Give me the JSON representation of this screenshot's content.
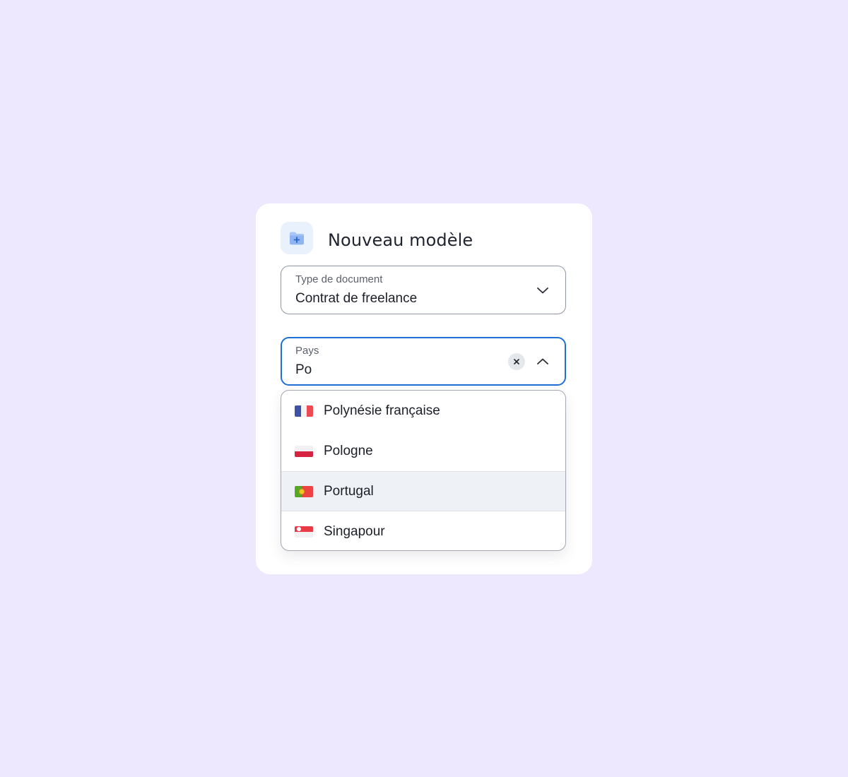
{
  "colors": {
    "background": "#ede8fd",
    "card": "#ffffff",
    "accent": "#1f6fd6",
    "icon_tile": "#e9f1fd"
  },
  "header": {
    "icon": "add-folder-icon",
    "title": "Nouveau modèle"
  },
  "document_type_field": {
    "label": "Type de document",
    "value": "Contrat de freelance",
    "icon": "chevron-down-icon"
  },
  "country_field": {
    "label": "Pays",
    "value": "Po",
    "clear_icon": "clear-icon",
    "toggle_icon": "chevron-up-icon"
  },
  "country_options": [
    {
      "label": "Polynésie française",
      "flag": "flag-french-polynesia-icon"
    },
    {
      "label": "Pologne",
      "flag": "flag-poland-icon"
    },
    {
      "label": "Portugal",
      "flag": "flag-portugal-icon",
      "highlighted": true
    },
    {
      "label": "Singapour",
      "flag": "flag-singapore-icon"
    }
  ]
}
